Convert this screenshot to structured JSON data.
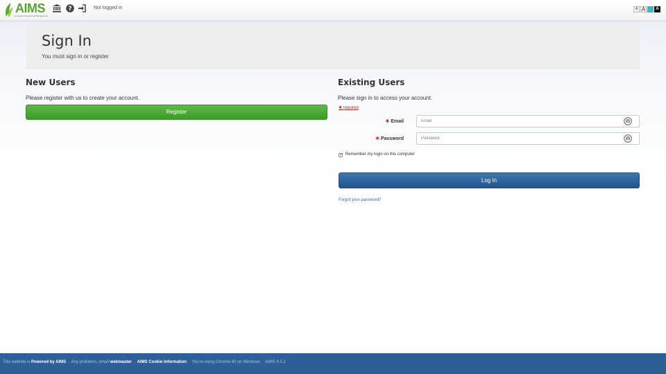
{
  "topbar": {
    "logo_text": "AIMS",
    "logo_subtitle": "Curriculum Programme Management",
    "icons": [
      "institution-icon",
      "help-icon",
      "sign-in-icon"
    ],
    "login_status": "Not logged in",
    "font_sizes": [
      "A",
      "A",
      "A",
      "A"
    ]
  },
  "hero": {
    "title": "Sign In",
    "subtitle": "You must sign in or register"
  },
  "new_users": {
    "heading": "New Users",
    "text": "Please register with us to create your account.",
    "register_label": "Register"
  },
  "existing_users": {
    "heading": "Existing Users",
    "text": "Please sign in to access your account.",
    "required_star": "✱",
    "required_label": "required",
    "email_label": "Email",
    "email_placeholder": "Email",
    "email_value": "",
    "password_label": "Password",
    "password_placeholder": "Password",
    "password_value": "",
    "remember_label": "Remember my login on this computer",
    "remember_checked": true,
    "login_label": "Log In",
    "forgot_label": "Forgot your password?"
  },
  "footer": {
    "p1": "This website is",
    "p2": "Powered by AIMS",
    "p3": "Any problems, email",
    "p4": "webmaster",
    "p5": "AIMS Cookie Information",
    "p6": "You're using Chrome 80 on Windows",
    "p7": "AIMS 4.0.1"
  },
  "colors": {
    "brand_green": "#5aa532",
    "register_green": "#4caf3a",
    "login_blue": "#2f67a0",
    "footer_blue": "#2f5f99",
    "required_red": "#c0392b"
  }
}
